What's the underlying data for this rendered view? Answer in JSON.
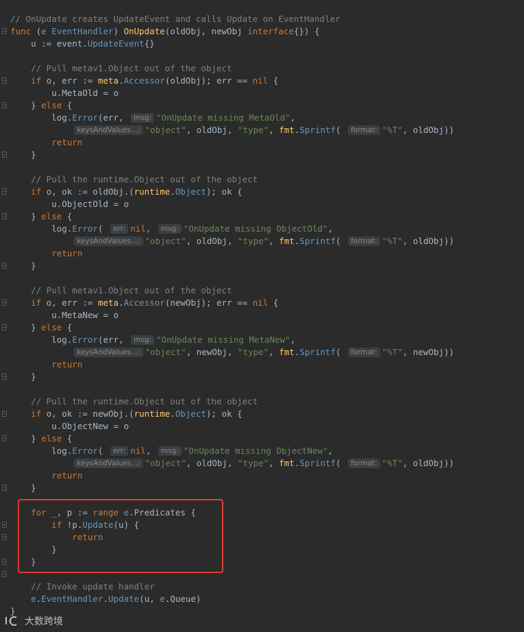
{
  "code_lines": [
    [
      [
        "cm",
        "// OnUpdate creates UpdateEvent and calls Update on EventHandler"
      ]
    ],
    [
      [
        "kw",
        "func "
      ],
      [
        "pk",
        "("
      ],
      [
        "tp",
        "e "
      ],
      [
        "tp",
        "EventHandler"
      ],
      [
        "pk",
        ") "
      ],
      [
        "fn",
        "OnUpdate"
      ],
      [
        "pk",
        "(oldObj, newObj "
      ],
      [
        "kw",
        "interface"
      ],
      [
        "pk",
        "{}) {"
      ]
    ],
    [
      [
        "pk",
        "    u := event."
      ],
      [
        "tp",
        "UpdateEvent"
      ],
      [
        "pk",
        "{}"
      ]
    ],
    [],
    [
      [
        "cm",
        "    // Pull metav1.Object out of the object"
      ]
    ],
    [
      [
        "kw",
        "    if "
      ],
      [
        "pk",
        "o, err := "
      ],
      [
        "mc",
        "meta"
      ],
      [
        "pk",
        "."
      ],
      [
        "tp",
        "Accessor"
      ],
      [
        "pk",
        "(oldObj); err == "
      ],
      [
        "kw",
        "nil"
      ],
      [
        "pk",
        " {"
      ]
    ],
    [
      [
        "pk",
        "        u.MetaOld = o"
      ]
    ],
    [
      [
        "pk",
        "    } "
      ],
      [
        "kw",
        "else"
      ],
      [
        "pk",
        " {"
      ]
    ],
    [
      [
        "pk",
        "        log."
      ],
      [
        "tp",
        "Error"
      ],
      [
        "pk",
        "(err, "
      ],
      [
        "hint",
        "msg:"
      ],
      [
        "st",
        "\"OnUpdate missing MetaOld\""
      ],
      [
        "pk",
        ","
      ]
    ],
    [
      [
        "pk",
        "            "
      ],
      [
        "hint",
        "keysAndValues...:"
      ],
      [
        "st",
        "\"object\""
      ],
      [
        "pk",
        ", oldObj, "
      ],
      [
        "st",
        "\"type\""
      ],
      [
        "pk",
        ", "
      ],
      [
        "mc",
        "fmt"
      ],
      [
        "pk",
        "."
      ],
      [
        "tp",
        "Sprintf"
      ],
      [
        "pk",
        "( "
      ],
      [
        "hint",
        "format:"
      ],
      [
        "st",
        "\"%T\""
      ],
      [
        "pk",
        ", oldObj))"
      ]
    ],
    [
      [
        "kw",
        "        return"
      ]
    ],
    [
      [
        "pk",
        "    }"
      ]
    ],
    [],
    [
      [
        "cm",
        "    // Pull the runtime.Object out of the object"
      ]
    ],
    [
      [
        "kw",
        "    if "
      ],
      [
        "pk",
        "o, ok := oldObj.("
      ],
      [
        "mc",
        "runtime"
      ],
      [
        "pk",
        "."
      ],
      [
        "tp",
        "Object"
      ],
      [
        "pk",
        "); ok {"
      ]
    ],
    [
      [
        "pk",
        "        u.ObjectOld = o"
      ]
    ],
    [
      [
        "pk",
        "    } "
      ],
      [
        "kw",
        "else"
      ],
      [
        "pk",
        " {"
      ]
    ],
    [
      [
        "pk",
        "        log."
      ],
      [
        "tp",
        "Error"
      ],
      [
        "pk",
        "( "
      ],
      [
        "hint",
        "err:"
      ],
      [
        "kw",
        "nil"
      ],
      [
        "pk",
        ", "
      ],
      [
        "hint",
        "msg:"
      ],
      [
        "st",
        "\"OnUpdate missing ObjectOld\""
      ],
      [
        "pk",
        ","
      ]
    ],
    [
      [
        "pk",
        "            "
      ],
      [
        "hint",
        "keysAndValues...:"
      ],
      [
        "st",
        "\"object\""
      ],
      [
        "pk",
        ", oldObj, "
      ],
      [
        "st",
        "\"type\""
      ],
      [
        "pk",
        ", "
      ],
      [
        "mc",
        "fmt"
      ],
      [
        "pk",
        "."
      ],
      [
        "tp",
        "Sprintf"
      ],
      [
        "pk",
        "( "
      ],
      [
        "hint",
        "format:"
      ],
      [
        "st",
        "\"%T\""
      ],
      [
        "pk",
        ", oldObj))"
      ]
    ],
    [
      [
        "kw",
        "        return"
      ]
    ],
    [
      [
        "pk",
        "    }"
      ]
    ],
    [],
    [
      [
        "cm",
        "    // Pull metav1.Object out of the object"
      ]
    ],
    [
      [
        "kw",
        "    if "
      ],
      [
        "pk",
        "o, err := "
      ],
      [
        "mc",
        "meta"
      ],
      [
        "pk",
        "."
      ],
      [
        "tp",
        "Accessor"
      ],
      [
        "pk",
        "(newObj); err == "
      ],
      [
        "kw",
        "nil"
      ],
      [
        "pk",
        " {"
      ]
    ],
    [
      [
        "pk",
        "        u.MetaNew = o"
      ]
    ],
    [
      [
        "pk",
        "    } "
      ],
      [
        "kw",
        "else"
      ],
      [
        "pk",
        " {"
      ]
    ],
    [
      [
        "pk",
        "        log."
      ],
      [
        "tp",
        "Error"
      ],
      [
        "pk",
        "(err, "
      ],
      [
        "hint",
        "msg:"
      ],
      [
        "st",
        "\"OnUpdate missing MetaNew\""
      ],
      [
        "pk",
        ","
      ]
    ],
    [
      [
        "pk",
        "            "
      ],
      [
        "hint",
        "keysAndValues...:"
      ],
      [
        "st",
        "\"object\""
      ],
      [
        "pk",
        ", newObj, "
      ],
      [
        "st",
        "\"type\""
      ],
      [
        "pk",
        ", "
      ],
      [
        "mc",
        "fmt"
      ],
      [
        "pk",
        "."
      ],
      [
        "tp",
        "Sprintf"
      ],
      [
        "pk",
        "( "
      ],
      [
        "hint",
        "format:"
      ],
      [
        "st",
        "\"%T\""
      ],
      [
        "pk",
        ", newObj))"
      ]
    ],
    [
      [
        "kw",
        "        return"
      ]
    ],
    [
      [
        "pk",
        "    }"
      ]
    ],
    [],
    [
      [
        "cm",
        "    // Pull the runtime.Object out of the object"
      ]
    ],
    [
      [
        "kw",
        "    if "
      ],
      [
        "pk",
        "o, ok := newObj.("
      ],
      [
        "mc",
        "runtime"
      ],
      [
        "pk",
        "."
      ],
      [
        "tp",
        "Object"
      ],
      [
        "pk",
        "); ok {"
      ]
    ],
    [
      [
        "pk",
        "        u.ObjectNew = o"
      ]
    ],
    [
      [
        "pk",
        "    } "
      ],
      [
        "kw",
        "else"
      ],
      [
        "pk",
        " {"
      ]
    ],
    [
      [
        "pk",
        "        log."
      ],
      [
        "tp",
        "Error"
      ],
      [
        "pk",
        "( "
      ],
      [
        "hint",
        "err:"
      ],
      [
        "kw",
        "nil"
      ],
      [
        "pk",
        ", "
      ],
      [
        "hint",
        "msg:"
      ],
      [
        "st",
        "\"OnUpdate missing ObjectNew\""
      ],
      [
        "pk",
        ","
      ]
    ],
    [
      [
        "pk",
        "            "
      ],
      [
        "hint",
        "keysAndValues...:"
      ],
      [
        "st",
        "\"object\""
      ],
      [
        "pk",
        ", oldObj, "
      ],
      [
        "st",
        "\"type\""
      ],
      [
        "pk",
        ", "
      ],
      [
        "mc",
        "fmt"
      ],
      [
        "pk",
        "."
      ],
      [
        "tp",
        "Sprintf"
      ],
      [
        "pk",
        "( "
      ],
      [
        "hint",
        "format:"
      ],
      [
        "st",
        "\"%T\""
      ],
      [
        "pk",
        ", oldObj))"
      ]
    ],
    [
      [
        "kw",
        "        return"
      ]
    ],
    [
      [
        "pk",
        "    }"
      ]
    ],
    [],
    [
      [
        "kw",
        "    for "
      ],
      [
        "pk",
        "_, p := "
      ],
      [
        "kw",
        "range "
      ],
      [
        "tp",
        "e"
      ],
      [
        "pk",
        ".Predicates {"
      ]
    ],
    [
      [
        "kw",
        "        if "
      ],
      [
        "pk",
        "!p."
      ],
      [
        "tp",
        "Update"
      ],
      [
        "pk",
        "(u) {"
      ]
    ],
    [
      [
        "kw",
        "            return"
      ]
    ],
    [
      [
        "pk",
        "        }"
      ]
    ],
    [
      [
        "pk",
        "    }"
      ]
    ],
    [],
    [
      [
        "cm",
        "    // Invoke update handler"
      ]
    ],
    [
      [
        "tp",
        "    e"
      ],
      [
        "pk",
        "."
      ],
      [
        "tp",
        "EventHandler"
      ],
      [
        "pk",
        "."
      ],
      [
        "tp",
        "Update"
      ],
      [
        "pk",
        "(u, "
      ],
      [
        "tp",
        "e"
      ],
      [
        "pk",
        ".Queue)"
      ]
    ],
    [
      [
        "pk",
        "}"
      ]
    ]
  ],
  "fold_lines": [
    1,
    5,
    7,
    11,
    14,
    16,
    20,
    23,
    25,
    29,
    32,
    34,
    38,
    41,
    42,
    44,
    45,
    49
  ],
  "watermark": {
    "text": "大数跨境"
  },
  "colors": {
    "background": "#2b2b2b",
    "keyword": "#cc7832",
    "comment": "#808080",
    "string": "#6a8759",
    "function": "#ffc66d",
    "highlight_border": "#e03c33"
  }
}
